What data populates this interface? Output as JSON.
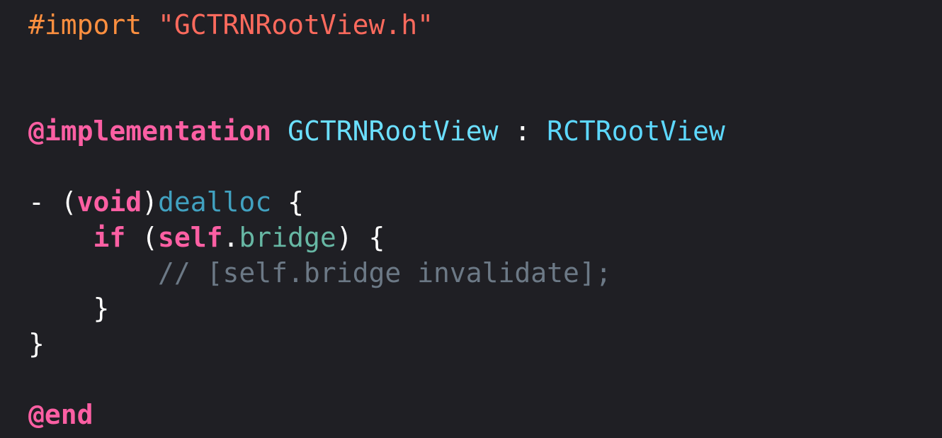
{
  "colors": {
    "background": "#1f1f24",
    "keyword": "#fc5fa3",
    "preprocessor": "#fd8f3f",
    "string": "#fc6a5d",
    "type_declaration": "#6bdfff",
    "type_reference": "#5dd8ff",
    "method_declaration": "#41a1c0",
    "property": "#67b7a4",
    "comment": "#6c7986",
    "plain": "#ffffff"
  },
  "code": {
    "import_directive": "#import",
    "import_path": "\"GCTRNRootView.h\"",
    "implementation_keyword": "@implementation",
    "class_name": "GCTRNRootView",
    "colon": " : ",
    "superclass_name": "RCTRootView",
    "method_prefix": "- (",
    "return_type": "void",
    "method_paren_close": ")",
    "method_name": "dealloc",
    "method_open_brace": " {",
    "if_indent": "    ",
    "if_keyword": "if",
    "if_paren_open": " (",
    "self_keyword": "self",
    "dot": ".",
    "bridge_property": "bridge",
    "if_paren_close": ") {",
    "comment_indent": "        ",
    "comment_text": "// [self.bridge invalidate];",
    "inner_close_indent": "    ",
    "inner_close_brace": "}",
    "method_close_brace": "}",
    "end_keyword": "@end"
  }
}
